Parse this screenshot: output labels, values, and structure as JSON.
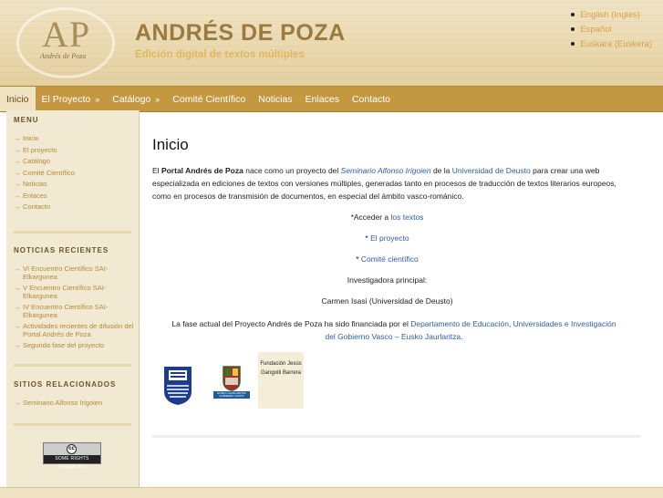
{
  "header": {
    "logo_letters": "AP",
    "logo_signature": "Andrés de Poza",
    "site_name": "ANDRÉS DE POZA",
    "slogan": "Edición digital de textos múltiples",
    "languages": [
      "English (Inglés)",
      "Español",
      "Euskara (Euskera)"
    ]
  },
  "nav": {
    "items": [
      "Inicio",
      "El Proyecto",
      "Catálogo",
      "Comité Científico",
      "Noticias",
      "Enlaces",
      "Contacto"
    ]
  },
  "sidebar": {
    "menu_title": "MENU",
    "menu_items": [
      "Inicio",
      "El proyecto",
      "Catálogo",
      "Comité Científico",
      "Noticias",
      "Enlaces",
      "Contacto"
    ],
    "news_title": "NOTICIAS RECIENTES",
    "news_items": [
      "VI Encuentro Científico SAI-Elkargunea",
      "V Encuentro Científico SAI-Elkargunea",
      "IV Encuentro Científico SAI-Elkargunea",
      "Actividades recientes de difusión del Portal Andrés de Poza",
      "Segunda fase del proyecto"
    ],
    "related_title": "SITIOS RELACIONADOS",
    "related_items": [
      "Seminario Alfonso Irigoien"
    ],
    "cc_label": "SOME RIGHTS RESERVED",
    "cc_symbol": "cc"
  },
  "main": {
    "title": "Inicio",
    "intro_prefix": "El",
    "intro_bold": "Portal Andrés de Poza",
    "intro_mid": "nace como un proyecto del",
    "intro_link1": "Seminario Alfonso Irigoien",
    "intro_mid2": "de la",
    "intro_link2": "Universidad de Deusto",
    "intro_rest": "para crear una web especializada en ediciones de textos con versiones múltiples, generadas tanto en procesos de traducción de textos literarios europeos, como en procesos de transmisión de documentos, en especial del ámbito vasco-románico.",
    "access_prefix": "*Acceder a",
    "access_link": "los textos",
    "project_prefix": "*",
    "project_link": "El proyecto",
    "committee_prefix": "*",
    "committee_link": "Comité científico",
    "researcher_label": "Investigadora principal:",
    "researcher_name": "Carmen Isasi (Universidad de Deusto)",
    "funding_text": "La fase actual del Proyecto Andrés de Poza ha sido financiada por el",
    "funding_link": "Departamento de Educación, Universidades e Investigación del Gobierno Vasco – Eusko Jaurlaritza",
    "funding_end": ".",
    "gov_logo_text": "EUSKO JAURLARITZA GOBIERNO VASCO",
    "foundation_text": "Fundación Jesús Gangoiti Barrera"
  }
}
